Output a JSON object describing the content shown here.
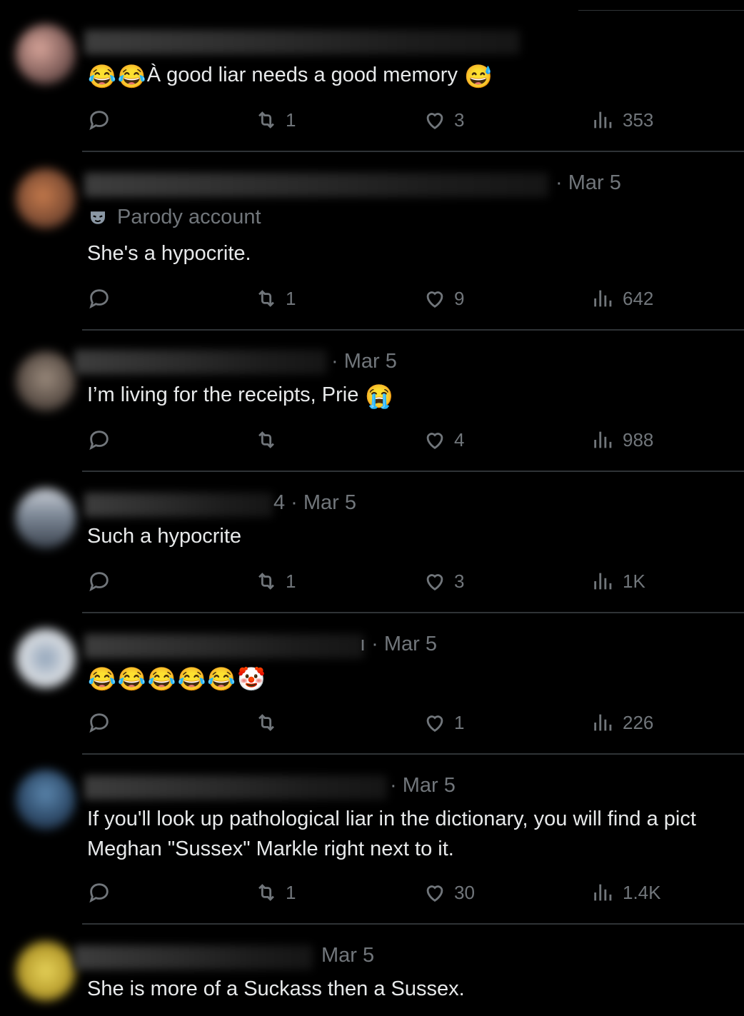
{
  "replies": [
    {
      "meta": "",
      "parody_label": "",
      "text": "À good liar needs a good memory",
      "prefix_emoji": [
        "😂",
        "😂"
      ],
      "suffix_emoji": [
        "😅"
      ],
      "replies_count": "",
      "reposts": "1",
      "likes": "3",
      "views": "353"
    },
    {
      "meta": "· Mar 5",
      "parody_label": "Parody account",
      "text": "She's a hypocrite.",
      "replies_count": "",
      "reposts": "1",
      "likes": "9",
      "views": "642"
    },
    {
      "meta": "· Mar 5",
      "parody_label": "",
      "text": "I’m living for the receipts, Prie",
      "suffix_emoji": [
        "😭"
      ],
      "replies_count": "",
      "reposts": "",
      "likes": "4",
      "views": "988"
    },
    {
      "meta": "4 · Mar 5",
      "parody_label": "",
      "text": "Such a hypocrite",
      "replies_count": "",
      "reposts": "1",
      "likes": "3",
      "views": "1K"
    },
    {
      "meta": "ı · Mar 5",
      "parody_label": "",
      "text": "",
      "emoji_line": [
        "😂",
        "😂",
        "😂",
        "😂",
        "😂",
        "🤡"
      ],
      "replies_count": "",
      "reposts": "",
      "likes": "1",
      "views": "226"
    },
    {
      "meta": "· Mar 5",
      "parody_label": "",
      "text_line1": "If you'll look up pathological liar in the dictionary, you will find a pict",
      "text_line2": "Meghan \"Sussex\" Markle right next to it.",
      "replies_count": "",
      "reposts": "1",
      "likes": "30",
      "views": "1.4K"
    },
    {
      "meta": "Mar 5",
      "parody_label": "",
      "text": "She is more of a Suckass then a Sussex."
    }
  ],
  "colors": {
    "background": "#000000",
    "text": "#e7e9ea",
    "muted": "#71767b",
    "divider": "#2f3336"
  },
  "icons": [
    "reply-icon",
    "repost-icon",
    "like-icon",
    "views-icon",
    "parody-mask-icon"
  ]
}
